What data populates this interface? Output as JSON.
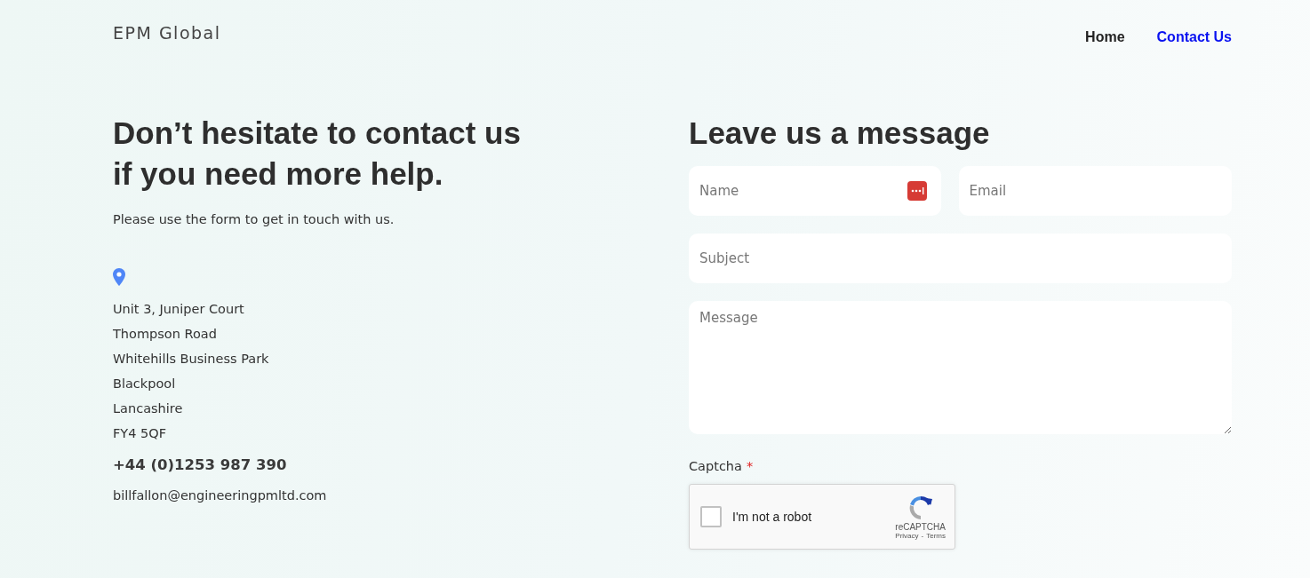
{
  "header": {
    "logo": "EPM Global",
    "nav": [
      {
        "label": "Home",
        "selected": false
      },
      {
        "label": "Contact Us",
        "selected": true
      }
    ]
  },
  "intro": {
    "heading_lines": [
      "Don’t hesitate to contact us",
      "if you need more help."
    ],
    "text": "Please use the form to get in touch with us."
  },
  "address": [
    "Unit 3, Juniper Court",
    "Thompson Road",
    "Whitehills Business Park",
    "Blackpool",
    "Lancashire",
    "FY4 5QF"
  ],
  "phone": "+44 (0)1253 987 390",
  "email": "billfallon@engineeringpmltd.com",
  "form": {
    "title": "Leave us a message",
    "name": {
      "placeholder": "Name"
    },
    "email": {
      "placeholder": "Email"
    },
    "subject": {
      "placeholder": "Subject"
    },
    "message": {
      "placeholder": "Message"
    },
    "captcha": {
      "label": "Captcha",
      "required_mark": "*",
      "checkbox_label": "I'm not a robot",
      "checked": false,
      "brand": "reCAPTCHA",
      "links": [
        "Privacy",
        "-",
        "Terms"
      ]
    }
  }
}
